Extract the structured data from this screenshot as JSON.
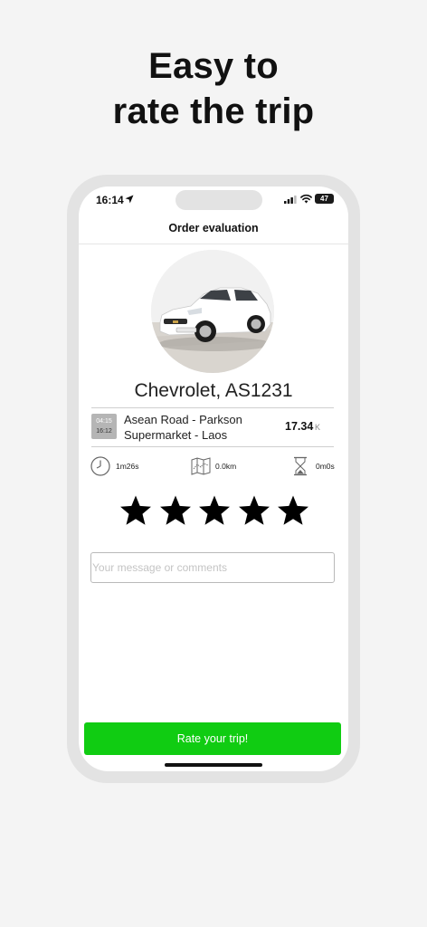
{
  "promo": {
    "headline_line1": "Easy to",
    "headline_line2": "rate the trip"
  },
  "status_bar": {
    "time": "16:14",
    "battery": "47",
    "icons": [
      "location-arrow-icon",
      "signal-bars-icon",
      "wifi-icon",
      "battery-icon"
    ]
  },
  "screen": {
    "title": "Order evaluation"
  },
  "car": {
    "name": "Chevrolet, AS1231",
    "photo": "car-photo"
  },
  "trip": {
    "start_time": "04:15",
    "end_time": "16:12",
    "route": "Asean Road - Parkson Supermarket - Laos",
    "price": "17.34",
    "currency": "K"
  },
  "stats": {
    "duration": "1m26s",
    "distance": "0.0km",
    "waiting": "0m0s",
    "icons": [
      "clock-icon",
      "route-map-icon",
      "hourglass-icon"
    ]
  },
  "rating": {
    "stars_filled": 5,
    "stars_total": 5
  },
  "comment": {
    "placeholder": "Your message or comments",
    "value": ""
  },
  "actions": {
    "rate_label": "Rate your trip!",
    "accent_color": "#10cc12"
  }
}
